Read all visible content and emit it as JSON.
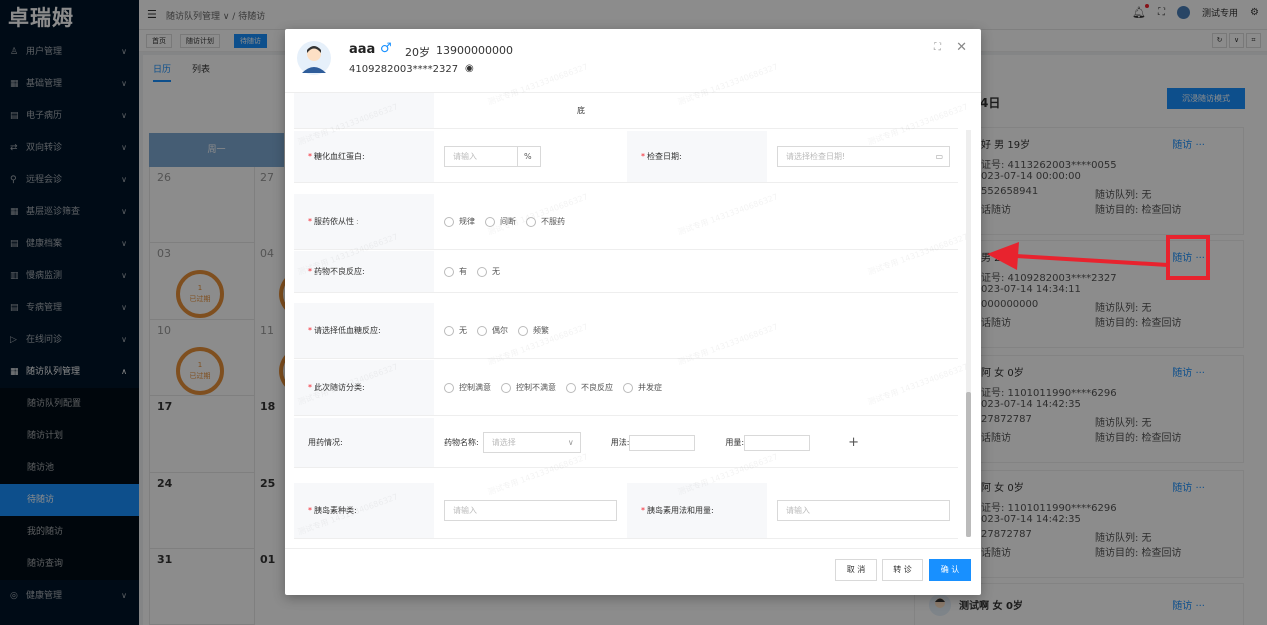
{
  "app": {
    "logo": "卓瑞姆"
  },
  "sidebar": {
    "items": [
      {
        "icon": "user-icon",
        "label": "用户管理"
      },
      {
        "icon": "grid-icon",
        "label": "基础管理"
      },
      {
        "icon": "record-icon",
        "label": "电子病历"
      },
      {
        "icon": "transfer-icon",
        "label": "双向转诊"
      },
      {
        "icon": "remote-icon",
        "label": "远程会诊"
      },
      {
        "icon": "screen-icon",
        "label": "基层巡诊筛查"
      },
      {
        "icon": "file-icon",
        "label": "健康档案"
      },
      {
        "icon": "monitor-icon",
        "label": "慢病监测"
      },
      {
        "icon": "disease-icon",
        "label": "专病管理"
      },
      {
        "icon": "online-icon",
        "label": "在线问诊"
      },
      {
        "icon": "queue-icon",
        "label": "随访队列管理"
      }
    ],
    "subitems": [
      "随访队列配置",
      "随访计划",
      "随访池",
      "待随访",
      "我的随访",
      "随访查询"
    ],
    "bottom": {
      "icon": "health-icon",
      "label": "健康管理"
    }
  },
  "topbar": {
    "breadcrumb": "随访队列管理 ∨ / 待随访",
    "user": "测试专用"
  },
  "tabs": [
    "首页",
    "随访计划",
    "待随访"
  ],
  "views": [
    "日历",
    "列表"
  ],
  "calendar": {
    "weekday": "周一",
    "rows": [
      {
        "num": "26",
        "num2": "27"
      },
      {
        "num": "03",
        "num2": "04",
        "total": "总计: 1",
        "count": "1",
        "status": "已过期"
      },
      {
        "num": "10",
        "num2": "11",
        "total": "总计: 1",
        "count": "1",
        "status": "已过期"
      },
      {
        "num": "17",
        "num2": "18"
      },
      {
        "num": "24",
        "num2": "25"
      },
      {
        "num": "31",
        "num2": "01"
      }
    ]
  },
  "rightpanel": {
    "title": "4日",
    "mode_button": "沉浸随访模式",
    "link": "随访",
    "more": "···",
    "cards": [
      {
        "name": "好 男 19岁",
        "id": "证号: 4113262003****0055",
        "time": "023-07-14 00:00:00",
        "phone": "552658941",
        "queue": "随访队列: 无",
        "type": "话随访",
        "purpose": "随访目的: 检查回访"
      },
      {
        "name": "男 2",
        "id": "证号: 4109282003****2327",
        "time": "023-07-14 14:34:11",
        "phone": "000000000",
        "queue": "随访队列: 无",
        "type": "话随访",
        "purpose": "随访目的: 检查回访"
      },
      {
        "name": "阿 女 0岁",
        "id": "证号: 1101011990****6296",
        "time": "023-07-14 14:42:35",
        "phone": "27872787",
        "queue": "随访队列: 无",
        "type": "话随访",
        "purpose": "随访目的: 检查回访"
      },
      {
        "name": "阿 女 0岁",
        "id": "证号: 1101011990****6296",
        "time": "023-07-14 14:42:35",
        "phone": "27872787",
        "queue": "随访队列: 无",
        "type": "话随访",
        "purpose": "随访目的: 检查回访"
      }
    ],
    "last": {
      "name": "测试啊 女 0岁"
    }
  },
  "modal": {
    "name": "aaa",
    "gender": "♂",
    "age": "20岁",
    "phone": "13900000000",
    "idcard": "4109282003****2327",
    "top_value": "底",
    "hba1c": {
      "label": "糖化血红蛋白:",
      "placeholder": "请输入",
      "unit": "%"
    },
    "check_date": {
      "label": "检查日期:",
      "placeholder": "请选择检查日期!"
    },
    "compliance": {
      "label": "服药依从性",
      "options": [
        "规律",
        "间断",
        "不服药"
      ]
    },
    "adverse": {
      "label": "药物不良反应:",
      "options": [
        "有",
        "无"
      ]
    },
    "hypo": {
      "label": "请选择低血糖反应:",
      "options": [
        "无",
        "偶尔",
        "频繁"
      ]
    },
    "category": {
      "label": "此次随访分类:",
      "options": [
        "控制满意",
        "控制不满意",
        "不良反应",
        "并发症"
      ]
    },
    "medication": {
      "label": "用药情况:",
      "drug_label": "药物名称:",
      "drug_placeholder": "请选择",
      "usage_label": "用法:",
      "dose_label": "用量:",
      "add": "+"
    },
    "insulin_type": {
      "label": "胰岛素种类:",
      "placeholder": "请输入"
    },
    "insulin_usage": {
      "label": "胰岛素用法和用量:",
      "placeholder": "请输入"
    },
    "buttons": {
      "cancel": "取 消",
      "transfer": "转 诊",
      "confirm": "确 认"
    },
    "watermark": "测试专用 14313340686327"
  },
  "colors": {
    "sidebar": "#001529",
    "accent": "#1890ff",
    "highlight": "#e8232e",
    "expired": "#e8913a"
  }
}
